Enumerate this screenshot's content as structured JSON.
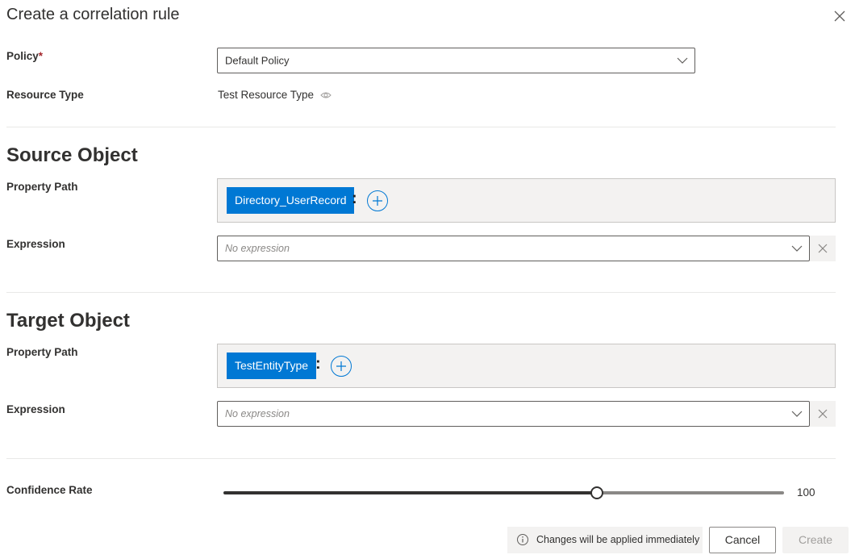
{
  "dialog": {
    "title": "Create a correlation rule"
  },
  "policy": {
    "label": "Policy",
    "required_marker": "*",
    "value": "Default Policy"
  },
  "resource_type": {
    "label": "Resource Type",
    "value": "Test Resource Type"
  },
  "source": {
    "heading": "Source Object",
    "property_path_label": "Property Path",
    "path_chip": "Directory_UserRecord",
    "separator": ":",
    "expression_label": "Expression",
    "expression_placeholder": "No expression"
  },
  "target": {
    "heading": "Target Object",
    "property_path_label": "Property Path",
    "path_chip": "TestEntityType",
    "separator": ":",
    "expression_label": "Expression",
    "expression_placeholder": "No expression"
  },
  "confidence": {
    "label": "Confidence Rate",
    "value": "100",
    "slider_fraction": 0.667
  },
  "footer": {
    "info_text": "Changes will be applied immediately",
    "cancel_label": "Cancel",
    "create_label": "Create"
  },
  "colors": {
    "accent": "#0078d4",
    "required": "#a4262c"
  },
  "icons": [
    "close-icon",
    "chevron-down-icon",
    "eye-icon",
    "plus-icon",
    "clear-icon",
    "info-icon"
  ]
}
